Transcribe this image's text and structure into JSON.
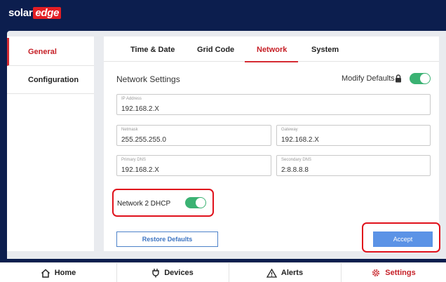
{
  "app": {
    "logo_left": "solar",
    "logo_right": "edge"
  },
  "sidebar": {
    "items": [
      {
        "label": "General",
        "active": true
      },
      {
        "label": "Configuration",
        "active": false
      }
    ]
  },
  "tabs": [
    {
      "label": "Time & Date"
    },
    {
      "label": "Grid Code"
    },
    {
      "label": "Network",
      "active": true
    },
    {
      "label": "System"
    }
  ],
  "section": {
    "title": "Network Settings",
    "modify_defaults_label": "Modify Defaults",
    "modify_defaults_on": true
  },
  "fields": {
    "ip_address": {
      "label": "IP Address",
      "value": "192.168.2.X"
    },
    "netmask": {
      "label": "Netmask",
      "value": "255.255.255.0"
    },
    "gateway": {
      "label": "Gateway",
      "value": "192.168.2.X"
    },
    "primary_dns": {
      "label": "Primary DNS",
      "value": "192.168.2.X"
    },
    "secondary_dns": {
      "label": "Secondary DNS",
      "value": "2:8.8.8.8"
    }
  },
  "dhcp": {
    "label": "Network 2 DHCP",
    "on": true
  },
  "buttons": {
    "restore": "Restore Defaults",
    "accept": "Accept"
  },
  "bottom_nav": [
    {
      "label": "Home",
      "icon": "home-icon"
    },
    {
      "label": "Devices",
      "icon": "plug-icon"
    },
    {
      "label": "Alerts",
      "icon": "warning-icon"
    },
    {
      "label": "Settings",
      "icon": "gear-icon",
      "active": true
    }
  ],
  "colors": {
    "accent": "#d52b32",
    "toggle_on": "#3bb273",
    "primary_button": "#5b93e6",
    "header": "#0c1e4e"
  }
}
